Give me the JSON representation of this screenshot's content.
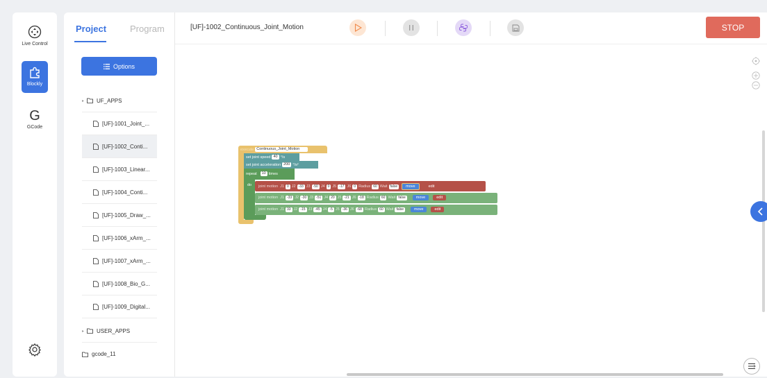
{
  "rail": {
    "live_control_label": "Live Control",
    "blockly_label": "Blockly",
    "gcode_glyph": "G",
    "gcode_label": "GCode"
  },
  "panel": {
    "tab_project": "Project",
    "tab_program": "Program",
    "options_label": "Options",
    "tree": [
      {
        "label": "UF_APPS",
        "kind": "folder",
        "icon": "folder-icon"
      },
      {
        "label": "[UF]-1001_Joint_...",
        "kind": "file",
        "icon": "file-icon"
      },
      {
        "label": "[UF]-1002_Conti...",
        "kind": "file",
        "icon": "file-icon",
        "selected": true
      },
      {
        "label": "[UF]-1003_Linear...",
        "kind": "file",
        "icon": "file-icon"
      },
      {
        "label": "[UF]-1004_Conti...",
        "kind": "file",
        "icon": "file-icon"
      },
      {
        "label": "[UF]-1005_Draw_...",
        "kind": "file",
        "icon": "file-icon"
      },
      {
        "label": "[UF]-1006_xArm_...",
        "kind": "file",
        "icon": "file-icon"
      },
      {
        "label": "[UF]-1007_xArm_...",
        "kind": "file",
        "icon": "file-icon"
      },
      {
        "label": "[UF]-1008_Bio_G...",
        "kind": "file",
        "icon": "file-icon"
      },
      {
        "label": "[UF]-1009_Digital...",
        "kind": "file",
        "icon": "file-icon"
      },
      {
        "label": "USER_APPS",
        "kind": "folder",
        "icon": "folder-icon"
      },
      {
        "label": "gcode_11",
        "kind": "folder",
        "icon": "folder-icon"
      }
    ]
  },
  "toolbar": {
    "project_title": "[UF]-1002_Continuous_Joint_Motion",
    "stop_label": "STOP"
  },
  "colors": {
    "accent": "#3c74e0",
    "stop": "#e06a5c",
    "play_bg": "#fde6d4",
    "python_bg": "#e4d9f7"
  },
  "blockly": {
    "func_keyword": "execute",
    "func_name": "Continuous_Joint_Motion",
    "speed_label": "set joint speed",
    "speed_value": "40",
    "speed_unit": "°/s",
    "accel_label": "set joint acceleration",
    "accel_value": "200",
    "accel_unit": "°/s²",
    "repeat_label": "repeat",
    "repeat_value": "10",
    "times_label": "times",
    "do_label": "do",
    "motions": [
      {
        "label": "joint motion",
        "j1": "0",
        "j2": "-33",
        "j3": "-50",
        "j4": "0",
        "j5": "-17",
        "j6": "0",
        "radius": "60",
        "wait": "false",
        "move": "move",
        "edit": "edit"
      },
      {
        "label": "joint motion",
        "j1": "-33",
        "j2": "-30",
        "j3": "-51",
        "j4": "20",
        "j5": "-21",
        "j6": "-18",
        "radius": "60",
        "wait": "false",
        "move": "move",
        "edit": "edit"
      },
      {
        "label": "joint motion",
        "j1": "33",
        "j2": "-15",
        "j3": "-45",
        "j4": "-5",
        "j5": "-36",
        "j6": "-68",
        "radius": "60",
        "wait": "false",
        "move": "move",
        "edit": "edit"
      }
    ],
    "j_labels": [
      "J1",
      "J2",
      "J3",
      "J4",
      "J5",
      "J6"
    ],
    "radius_label": "Radius",
    "wait_label": "Wait"
  }
}
